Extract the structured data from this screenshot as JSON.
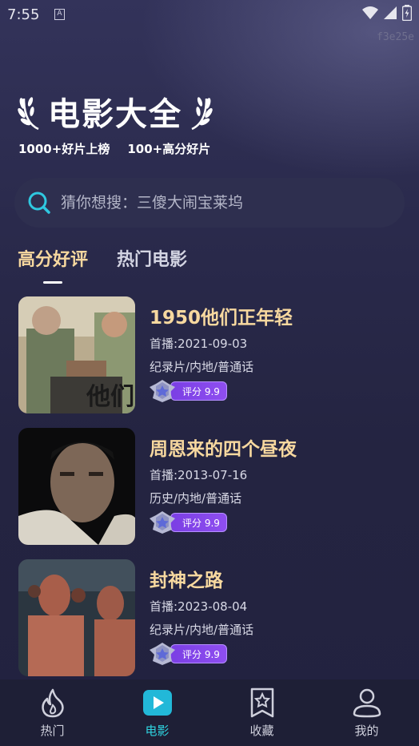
{
  "status_bar": {
    "time": "7:55",
    "notification_glyph": "A"
  },
  "build_tag": "f3e25e",
  "hero": {
    "title": "电影大全",
    "stats": [
      "1000+好片上榜",
      "100+高分好片"
    ]
  },
  "search": {
    "placeholder": "猜你想搜：三傻大闹宝莱坞"
  },
  "tabs": [
    {
      "label": "高分好评",
      "active": true
    },
    {
      "label": "热门电影",
      "active": false
    }
  ],
  "movies": [
    {
      "title": "1950他们正年轻",
      "date": "首播:2021-09-03",
      "genre": "纪录片/内地/普通话",
      "rating": "评分 9.9"
    },
    {
      "title": "周恩来的四个昼夜",
      "date": "首播:2013-07-16",
      "genre": "历史/内地/普通话",
      "rating": "评分 9.9"
    },
    {
      "title": "封神之路",
      "date": "首播:2023-08-04",
      "genre": "纪录片/内地/普通话",
      "rating": "评分 9.9"
    }
  ],
  "bottom_nav": [
    {
      "label": "热门",
      "icon": "flame-icon",
      "active": false
    },
    {
      "label": "电影",
      "icon": "play-icon",
      "active": true
    },
    {
      "label": "收藏",
      "icon": "bookmark-star-icon",
      "active": false
    },
    {
      "label": "我的",
      "icon": "user-icon",
      "active": false
    }
  ],
  "colors": {
    "accent_gold": "#f7d89f",
    "accent_cyan": "#2fd4e0",
    "rating_purple": "#8e4ef0"
  }
}
